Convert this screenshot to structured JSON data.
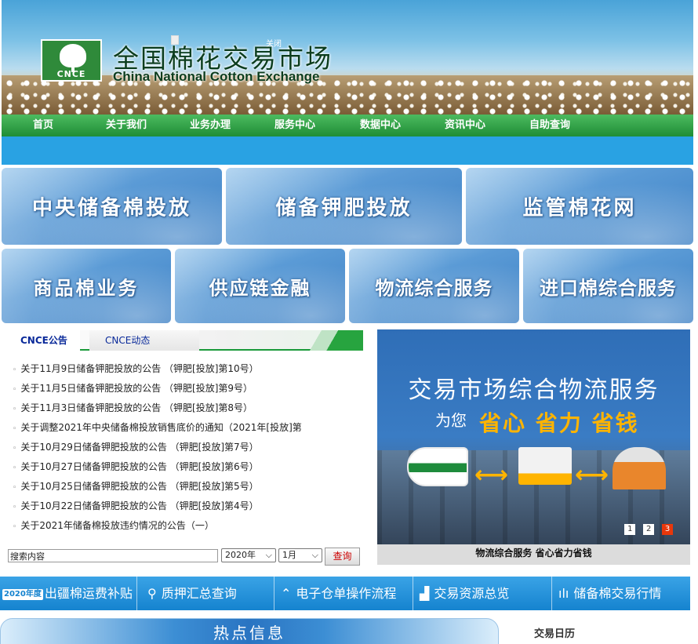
{
  "header": {
    "site_title": "全国棉花交易市场",
    "site_subtitle": "China National Cotton Exchange",
    "logo_text": "CNCE",
    "close_text": "关闭"
  },
  "nav": {
    "items": [
      "首页",
      "关于我们",
      "业务办理",
      "服务中心",
      "数据中心",
      "资讯中心",
      "自助查询"
    ]
  },
  "tiles": {
    "row1": [
      "中央储备棉投放",
      "储备钾肥投放",
      "监管棉花网"
    ],
    "row2": [
      "商品棉业务",
      "供应链金融",
      "物流综合服务",
      "进口棉综合服务"
    ]
  },
  "announcements": {
    "tabs": [
      "CNCE公告",
      "CNCE动态"
    ],
    "items": [
      "关于11月9日储备钾肥投放的公告 （钾肥[投放]第10号）",
      "关于11月5日储备钾肥投放的公告 （钾肥[投放]第9号）",
      "关于11月3日储备钾肥投放的公告 （钾肥[投放]第8号）",
      "关于调整2021年中央储备棉投放销售底价的通知（2021年[投放]第",
      "关于10月29日储备钾肥投放的公告 （钾肥[投放]第7号）",
      "关于10月27日储备钾肥投放的公告 （钾肥[投放]第6号）",
      "关于10月25日储备钾肥投放的公告 （钾肥[投放]第5号）",
      "关于10月22日储备钾肥投放的公告 （钾肥[投放]第4号）",
      "关于2021年储备棉投放违约情况的公告（一）"
    ]
  },
  "search": {
    "placeholder": "搜索内容",
    "year": "2020年",
    "month": "1月",
    "button": "查询"
  },
  "slideshow": {
    "headline": "交易市场综合物流服务",
    "for_you": "为您",
    "slogan": "省心 省力 省钱",
    "pages": [
      "1",
      "2",
      "3"
    ],
    "active_page": "3",
    "caption": "物流综合服务 省心省力省钱",
    "accent": "#ffb400"
  },
  "quickbar": {
    "badge": "2020年度",
    "items": [
      "出疆棉运费补贴",
      "质押汇总查询",
      "电子仓单操作流程",
      "交易资源总览",
      "储备棉交易行情"
    ],
    "icons": [
      "search-icon",
      "trend-icon",
      "blocks-icon",
      "bar-chart-icon"
    ]
  },
  "bottom": {
    "hot_title": "热点信息",
    "calendar_title": "交易日历"
  },
  "colors": {
    "nav_green": "#1f8d35",
    "sky_blue": "#29a2e3",
    "link_blue": "#0a2a9a",
    "active_dot": "#e8370b"
  }
}
